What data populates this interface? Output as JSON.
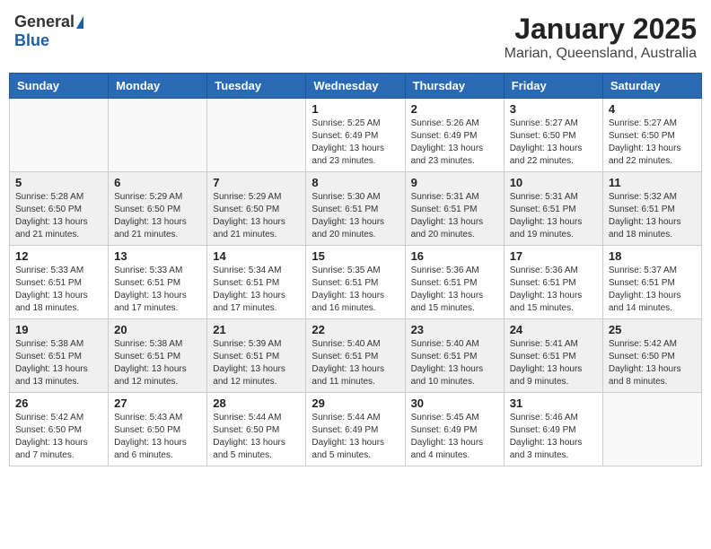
{
  "logo": {
    "general": "General",
    "blue": "Blue"
  },
  "title": "January 2025",
  "subtitle": "Marian, Queensland, Australia",
  "days_of_week": [
    "Sunday",
    "Monday",
    "Tuesday",
    "Wednesday",
    "Thursday",
    "Friday",
    "Saturday"
  ],
  "weeks": [
    {
      "row_bg": "light",
      "days": [
        {
          "num": "",
          "info": ""
        },
        {
          "num": "",
          "info": ""
        },
        {
          "num": "",
          "info": ""
        },
        {
          "num": "1",
          "info": "Sunrise: 5:25 AM\nSunset: 6:49 PM\nDaylight: 13 hours\nand 23 minutes."
        },
        {
          "num": "2",
          "info": "Sunrise: 5:26 AM\nSunset: 6:49 PM\nDaylight: 13 hours\nand 23 minutes."
        },
        {
          "num": "3",
          "info": "Sunrise: 5:27 AM\nSunset: 6:50 PM\nDaylight: 13 hours\nand 22 minutes."
        },
        {
          "num": "4",
          "info": "Sunrise: 5:27 AM\nSunset: 6:50 PM\nDaylight: 13 hours\nand 22 minutes."
        }
      ]
    },
    {
      "row_bg": "dark",
      "days": [
        {
          "num": "5",
          "info": "Sunrise: 5:28 AM\nSunset: 6:50 PM\nDaylight: 13 hours\nand 21 minutes."
        },
        {
          "num": "6",
          "info": "Sunrise: 5:29 AM\nSunset: 6:50 PM\nDaylight: 13 hours\nand 21 minutes."
        },
        {
          "num": "7",
          "info": "Sunrise: 5:29 AM\nSunset: 6:50 PM\nDaylight: 13 hours\nand 21 minutes."
        },
        {
          "num": "8",
          "info": "Sunrise: 5:30 AM\nSunset: 6:51 PM\nDaylight: 13 hours\nand 20 minutes."
        },
        {
          "num": "9",
          "info": "Sunrise: 5:31 AM\nSunset: 6:51 PM\nDaylight: 13 hours\nand 20 minutes."
        },
        {
          "num": "10",
          "info": "Sunrise: 5:31 AM\nSunset: 6:51 PM\nDaylight: 13 hours\nand 19 minutes."
        },
        {
          "num": "11",
          "info": "Sunrise: 5:32 AM\nSunset: 6:51 PM\nDaylight: 13 hours\nand 18 minutes."
        }
      ]
    },
    {
      "row_bg": "light",
      "days": [
        {
          "num": "12",
          "info": "Sunrise: 5:33 AM\nSunset: 6:51 PM\nDaylight: 13 hours\nand 18 minutes."
        },
        {
          "num": "13",
          "info": "Sunrise: 5:33 AM\nSunset: 6:51 PM\nDaylight: 13 hours\nand 17 minutes."
        },
        {
          "num": "14",
          "info": "Sunrise: 5:34 AM\nSunset: 6:51 PM\nDaylight: 13 hours\nand 17 minutes."
        },
        {
          "num": "15",
          "info": "Sunrise: 5:35 AM\nSunset: 6:51 PM\nDaylight: 13 hours\nand 16 minutes."
        },
        {
          "num": "16",
          "info": "Sunrise: 5:36 AM\nSunset: 6:51 PM\nDaylight: 13 hours\nand 15 minutes."
        },
        {
          "num": "17",
          "info": "Sunrise: 5:36 AM\nSunset: 6:51 PM\nDaylight: 13 hours\nand 15 minutes."
        },
        {
          "num": "18",
          "info": "Sunrise: 5:37 AM\nSunset: 6:51 PM\nDaylight: 13 hours\nand 14 minutes."
        }
      ]
    },
    {
      "row_bg": "dark",
      "days": [
        {
          "num": "19",
          "info": "Sunrise: 5:38 AM\nSunset: 6:51 PM\nDaylight: 13 hours\nand 13 minutes."
        },
        {
          "num": "20",
          "info": "Sunrise: 5:38 AM\nSunset: 6:51 PM\nDaylight: 13 hours\nand 12 minutes."
        },
        {
          "num": "21",
          "info": "Sunrise: 5:39 AM\nSunset: 6:51 PM\nDaylight: 13 hours\nand 12 minutes."
        },
        {
          "num": "22",
          "info": "Sunrise: 5:40 AM\nSunset: 6:51 PM\nDaylight: 13 hours\nand 11 minutes."
        },
        {
          "num": "23",
          "info": "Sunrise: 5:40 AM\nSunset: 6:51 PM\nDaylight: 13 hours\nand 10 minutes."
        },
        {
          "num": "24",
          "info": "Sunrise: 5:41 AM\nSunset: 6:51 PM\nDaylight: 13 hours\nand 9 minutes."
        },
        {
          "num": "25",
          "info": "Sunrise: 5:42 AM\nSunset: 6:50 PM\nDaylight: 13 hours\nand 8 minutes."
        }
      ]
    },
    {
      "row_bg": "light",
      "days": [
        {
          "num": "26",
          "info": "Sunrise: 5:42 AM\nSunset: 6:50 PM\nDaylight: 13 hours\nand 7 minutes."
        },
        {
          "num": "27",
          "info": "Sunrise: 5:43 AM\nSunset: 6:50 PM\nDaylight: 13 hours\nand 6 minutes."
        },
        {
          "num": "28",
          "info": "Sunrise: 5:44 AM\nSunset: 6:50 PM\nDaylight: 13 hours\nand 5 minutes."
        },
        {
          "num": "29",
          "info": "Sunrise: 5:44 AM\nSunset: 6:49 PM\nDaylight: 13 hours\nand 5 minutes."
        },
        {
          "num": "30",
          "info": "Sunrise: 5:45 AM\nSunset: 6:49 PM\nDaylight: 13 hours\nand 4 minutes."
        },
        {
          "num": "31",
          "info": "Sunrise: 5:46 AM\nSunset: 6:49 PM\nDaylight: 13 hours\nand 3 minutes."
        },
        {
          "num": "",
          "info": ""
        }
      ]
    }
  ]
}
